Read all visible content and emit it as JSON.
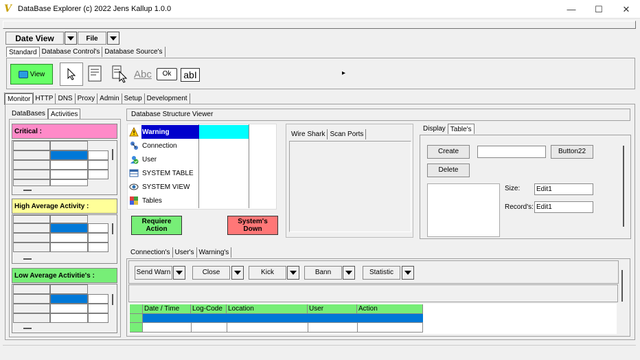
{
  "window": {
    "title": "DataBase Explorer (c) 2022 Jens Kallup 1.0.0",
    "app_icon": "V",
    "minimize": "—",
    "maximize": "☐",
    "close": "✕"
  },
  "menubar": {
    "date_view": "Date View",
    "file": "File"
  },
  "toolbar_tabs": [
    "Standard",
    "Database Control's",
    "Database Source's"
  ],
  "toolbar": {
    "view_label": "View",
    "abc_label": "Abc",
    "ok_label": "Ok",
    "edit_label": "abI",
    "more": "▸"
  },
  "monitor_tabs": [
    "Monitor",
    "HTTP",
    "DNS",
    "Proxy",
    "Admin",
    "Setup",
    "Development"
  ],
  "left_tabs": [
    "DataBases",
    "Activities"
  ],
  "activity_panels": [
    {
      "title": "Critical :",
      "color": "#ff8ac8"
    },
    {
      "title": "High Average Activity :",
      "color": "#ffff99"
    },
    {
      "title": "Low Average Activitie's :",
      "color": "#77ee77"
    }
  ],
  "structure_viewer": {
    "title": "Database Structure Viewer",
    "items": [
      "Warning",
      "Connection",
      "User",
      "SYSTEM TABLE",
      "SYSTEM VIEW",
      "Tables"
    ],
    "icons": [
      "warning-icon",
      "connection-icon",
      "user-icon",
      "system-table-icon",
      "system-view-icon",
      "tables-icon"
    ],
    "require_action": "Requiere Action",
    "system_down": "System's Down"
  },
  "middle_tabs": [
    "Wire Shark",
    "Scan Ports"
  ],
  "right_tabs": [
    "Display",
    "Table's"
  ],
  "table_panel": {
    "create": "Create",
    "delete": "Delete",
    "button22": "Button22",
    "size_label": "Size:",
    "size_value": "Edit1",
    "records_label": "Record's:",
    "records_value": "Edit1",
    "name_value": ""
  },
  "bottom_tabs": [
    "Connection's",
    "User's",
    "Warning's"
  ],
  "bottom_toolbar": [
    "Send Warn",
    "Close",
    "Kick",
    "Bann",
    "Statistic"
  ],
  "log_table": {
    "columns": [
      "Date / Time",
      "Log-Code",
      "Location",
      "User",
      "Action"
    ]
  },
  "colors": {
    "selection": "#0078d7",
    "cyan": "#00ffff",
    "green": "#77ee77",
    "red": "#ff7777",
    "warning_sel": "#0000cc"
  }
}
